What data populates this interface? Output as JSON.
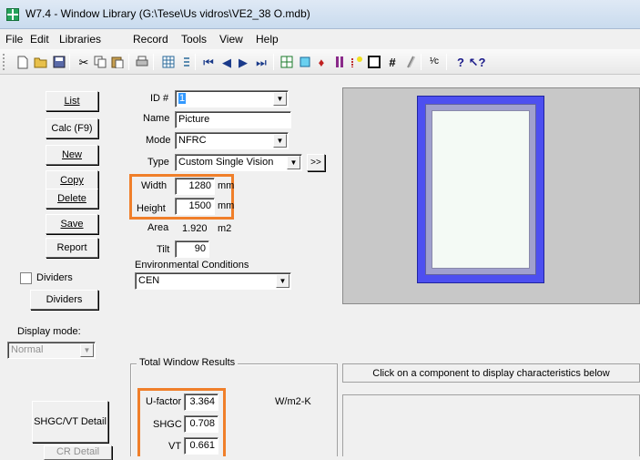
{
  "window": {
    "title": "W7.4 - Window Library (G:\\Tese\\Us vidros\\VE2_38 O.mdb)"
  },
  "menu": [
    "File",
    "Edit",
    "Libraries",
    "Record",
    "Tools",
    "View",
    "Help"
  ],
  "toolbar": {
    "icons": [
      "new-icon",
      "open-icon",
      "save-icon",
      "cut-icon",
      "copy-icon",
      "paste-icon",
      "print-icon",
      "grid-icon",
      "list-icon",
      "first-record-icon",
      "prev-record-icon",
      "next-record-icon",
      "last-record-icon",
      "table-icon",
      "glazing-icon",
      "gas-icon",
      "divider-icon",
      "shading-icon",
      "frame-icon",
      "hash-icon",
      "spacer-icon",
      "units-icon",
      "help-icon",
      "context-help-icon"
    ],
    "units_label": "¹⁄c"
  },
  "buttons": {
    "list": "List",
    "calc": "Calc (F9)",
    "new": "New",
    "copy": "Copy",
    "delete": "Delete",
    "save": "Save",
    "report": "Report",
    "dividers": "Dividers",
    "shgc_detail": "SHGC/VT Detail",
    "cr_detail": "CR Detail",
    "expand": ">>"
  },
  "dividers_checkbox": {
    "label": "Dividers",
    "checked": false
  },
  "display_mode": {
    "label": "Display mode:",
    "value": "Normal"
  },
  "form": {
    "id_label": "ID #",
    "id_value": "1",
    "name_label": "Name",
    "name_value": "Picture",
    "mode_label": "Mode",
    "mode_value": "NFRC",
    "type_label": "Type",
    "type_value": "Custom Single Vision",
    "width_label": "Width",
    "width_value": "1280",
    "width_unit": "mm",
    "height_label": "Height",
    "height_value": "1500",
    "height_unit": "mm",
    "area_label": "Area",
    "area_value": "1.920",
    "area_unit": "m2",
    "tilt_label": "Tilt",
    "tilt_value": "90",
    "env_label": "Environmental Conditions",
    "env_value": "CEN"
  },
  "results": {
    "group_title": "Total Window Results",
    "ufactor_label": "U-factor",
    "ufactor_value": "3.364",
    "ufactor_unit": "W/m2-K",
    "shgc_label": "SHGC",
    "shgc_value": "0.708",
    "vt_label": "VT",
    "vt_value": "0.661"
  },
  "info_text": "Click on a component to display characteristics below",
  "colors": {
    "highlight": "#f07f2a",
    "frame": "#4d4ff0",
    "selection": "#3399ff"
  }
}
